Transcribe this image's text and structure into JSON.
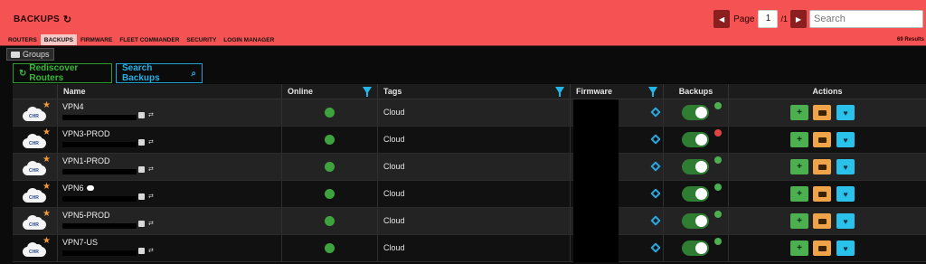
{
  "header": {
    "title": "BACKUPS",
    "page_label": "Page",
    "page_number": "1",
    "page_of": "/1",
    "search_placeholder": "Search",
    "results": "69 Results",
    "prev_icon": "caret-left-icon",
    "next_icon": "caret-right-icon"
  },
  "tabs": [
    "ROUTERS",
    "BACKUPS",
    "FIRMWARE",
    "FLEET COMMANDER",
    "SECURITY",
    "LOGIN MANAGER"
  ],
  "active_tab": "BACKUPS",
  "groups_label": "Groups",
  "buttons": {
    "rediscover": "Rediscover Routers",
    "search_backups": "Search Backups"
  },
  "columns": [
    "Name",
    "Online",
    "Tags",
    "Firmware",
    "Backups",
    "Actions"
  ],
  "rows": [
    {
      "name": "VPN4",
      "tag": "Cloud",
      "online": true,
      "backup_status": "ok",
      "chat": false
    },
    {
      "name": "VPN3-PROD",
      "tag": "Cloud",
      "online": true,
      "backup_status": "error",
      "chat": false
    },
    {
      "name": "VPN1-PROD",
      "tag": "Cloud",
      "online": true,
      "backup_status": "ok",
      "chat": false
    },
    {
      "name": "VPN6",
      "tag": "Cloud",
      "online": true,
      "backup_status": "ok",
      "chat": true
    },
    {
      "name": "VPN5-PROD",
      "tag": "Cloud",
      "online": true,
      "backup_status": "ok",
      "chat": false
    },
    {
      "name": "VPN7-US",
      "tag": "Cloud",
      "online": true,
      "backup_status": "ok",
      "chat": false
    }
  ],
  "colors": {
    "header_bg": "#f55353",
    "online": "#3fa43f",
    "toggle_on": "#2e7d32",
    "accent_blue": "#23b1e6",
    "accent_green": "#35b935"
  }
}
